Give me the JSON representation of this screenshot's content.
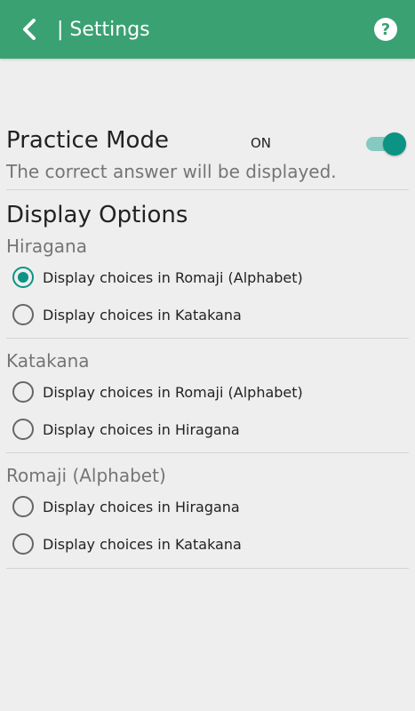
{
  "appbar": {
    "title": "| Settings",
    "back_icon": "chevron-left-icon",
    "help_icon": "help-circle-icon",
    "help_glyph": "?",
    "color": "#3aa173"
  },
  "practice": {
    "title": "Practice Mode",
    "state": "ON",
    "description": "The correct answer will be displayed.",
    "enabled": true
  },
  "display_options": {
    "title": "Display Options",
    "groups": [
      {
        "title": "Hiragana",
        "options": [
          {
            "label": "Display choices in Romaji (Alphabet)",
            "selected": true
          },
          {
            "label": "Display choices in Katakana",
            "selected": false
          }
        ]
      },
      {
        "title": "Katakana",
        "options": [
          {
            "label": "Display choices in Romaji (Alphabet)",
            "selected": false
          },
          {
            "label": "Display choices in Hiragana",
            "selected": false
          }
        ]
      },
      {
        "title": "Romaji (Alphabet)",
        "options": [
          {
            "label": "Display choices in Hiragana",
            "selected": false
          },
          {
            "label": "Display choices in Katakana",
            "selected": false
          }
        ]
      }
    ]
  },
  "colors": {
    "accent": "#0b9384",
    "toggle_track": "#86c9c1",
    "background": "#eeeeee"
  }
}
